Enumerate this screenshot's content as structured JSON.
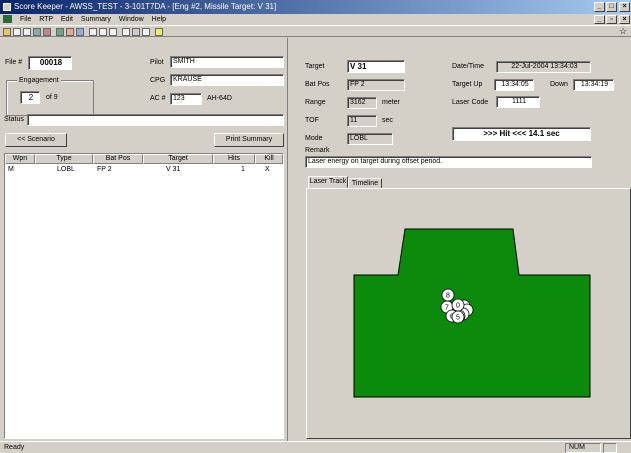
{
  "window": {
    "title": "Score Keeper - AWSS_TEST - 3-101T7DA - [Eng #2, Missile Target: V 31]",
    "buttons": [
      "_",
      "□",
      "×"
    ],
    "mdi_buttons": [
      "_",
      "▫",
      "×"
    ]
  },
  "menu": [
    "File",
    "RTP",
    "Edit",
    "Summary",
    "Window",
    "Help"
  ],
  "toolbar": {
    "icons": [
      "open-icon",
      "new-icon",
      "new2-icon",
      "save-icon",
      "tools-icon",
      "chart-icon",
      "pin-icon",
      "user-icon",
      "doc-icon",
      "doc2-icon",
      "doc3-icon",
      "graph-icon",
      "print-icon",
      "cut-icon",
      "help-icon"
    ],
    "right_icon": "☆"
  },
  "left": {
    "file_label": "File #",
    "file_value": "00018",
    "engagement_label": "Engagement",
    "engagement_value": "2",
    "engagement_of": "of  9",
    "pilot_label": "Pilot",
    "pilot_value": "SMITH",
    "cpg_label": "CPG",
    "cpg_value": "KRAUSE",
    "ac_label": "AC #",
    "ac_value": "123",
    "ac_type": "AH-64D",
    "status_label": "Status",
    "status_value": "",
    "scenario_button": "<< Scenario",
    "print_button": "Print Summary",
    "table": {
      "headers": [
        "Wpn",
        "Type",
        "Bat Pos",
        "Target",
        "Hits",
        "Kill"
      ],
      "rows": [
        [
          "M",
          "LOBL",
          "FP 2",
          "V 31",
          "1",
          "X"
        ]
      ]
    }
  },
  "right": {
    "target_label": "Target",
    "target_value": "V 31",
    "batpos_label": "Bat Pos",
    "batpos_value": "FP 2",
    "range_label": "Range",
    "range_value": "3162",
    "range_unit": "meter",
    "tof_label": "TOF",
    "tof_value": "11",
    "tof_unit": "sec",
    "mode_label": "Mode",
    "mode_value": "LOBL",
    "datetime_label": "Date/Time",
    "datetime_value": "22-Jul-2004 13:34:03",
    "target_up_label": "Target   Up",
    "target_up_value": "13:34:05",
    "down_label": "Down",
    "down_value": "13:34:19",
    "laser_code_label": "Laser Code",
    "laser_code_value": "1111",
    "hit_text": ">>>  Hit  <<<   14.1 sec",
    "remark_label": "Remark",
    "remark_value": "Laser energy on target during offset period.",
    "tabs": [
      "Laser Track",
      "Timeline"
    ],
    "track_points": [
      "8",
      "7",
      "0",
      "6",
      "5"
    ],
    "colors": {
      "target": "#0c8a0c",
      "outline": "#000000"
    }
  },
  "status": {
    "text": "Ready",
    "num": "NUM"
  }
}
